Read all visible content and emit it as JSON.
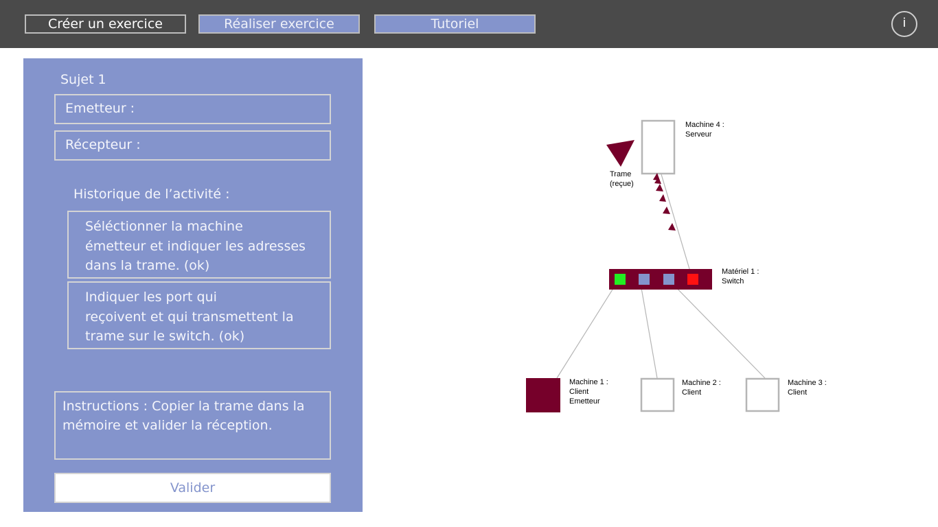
{
  "header": {
    "tabs": [
      {
        "label": "Créer un exercice"
      },
      {
        "label": "Réaliser exercice"
      },
      {
        "label": "Tutoriel"
      }
    ],
    "info_label": "i"
  },
  "panel": {
    "subject": "Sujet 1",
    "emitter_label": "Emetteur :",
    "receiver_label": "Récepteur :",
    "history_title": "Historique de l’activité :",
    "history": [
      {
        "line1": "Séléctionner la machine",
        "line2": "émetteur et indiquer les adresses",
        "line3": "dans la trame. (ok)"
      },
      {
        "line1": "Indiquer les port qui",
        "line2": "reçoivent et qui transmettent la",
        "line3": "trame sur le switch. (ok)"
      }
    ],
    "instructions_line1": "Instructions : Copier la trame dans la",
    "instructions_line2": "mémoire et valider la réception.",
    "validate_label": "Valider"
  },
  "diagram": {
    "server": {
      "line1": "Machine 4 :",
      "line2": "Serveur"
    },
    "frame": {
      "line1": "Trame",
      "line2": "(reçue)"
    },
    "switch": {
      "line1": "Matériel 1 :",
      "line2": "Switch"
    },
    "ports": [
      {
        "state": "receiving",
        "color": "#22ee22"
      },
      {
        "state": "idle",
        "color": "#8494cc"
      },
      {
        "state": "idle",
        "color": "#8494cc"
      },
      {
        "state": "transmitting",
        "color": "#ff1111"
      }
    ],
    "machine1": {
      "line1": "Machine 1 :",
      "line2": "Client",
      "line3": "Emetteur"
    },
    "machine2": {
      "line1": "Machine 2 :",
      "line2": "Client"
    },
    "machine3": {
      "line1": "Machine 3 :",
      "line2": "Client"
    }
  },
  "colors": {
    "topbar": "#4a4a4a",
    "accent": "#8494cc",
    "switch": "#76002a",
    "emitter": "#76002a"
  }
}
